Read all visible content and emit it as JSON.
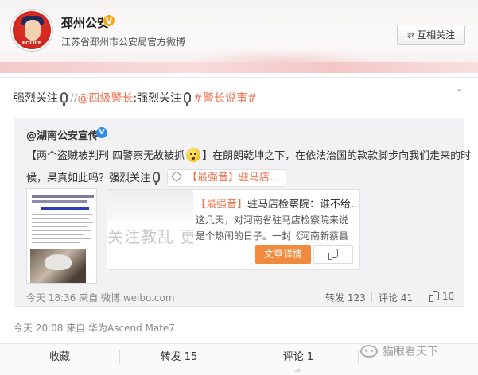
{
  "header": {
    "account_name": "邳州公安",
    "verified_badge": "V",
    "description": "江苏省邳州市公安局官方微博",
    "follow_button": "互相关注",
    "follow_icon": "mutual-follow-arrows"
  },
  "post": {
    "more_icon": "chevron-down-icon",
    "text_prefix": "强烈关注",
    "separator": "//",
    "mention": "@四级警长",
    "mention_colon": ":强烈关注",
    "hashtag": "#警长说事#",
    "time": "今天 20:08 来自 华为Ascend Mate7"
  },
  "quoted": {
    "author": "@湖南公安宣传",
    "verified_badge": "V",
    "line1_before_emoji": "【两个盗贼被判刑 四警察无故被抓",
    "line1_after_emoji": "】在朗朗乾坤之下，在依法治国的款款脚步向我们走来的时",
    "line2": "候，果真如此吗？强烈关注",
    "link_chip": "【最强音】驻马店...",
    "card": {
      "title_highlight": "【最强音】",
      "title_rest": "驻马店检察院：谁不给...",
      "desc_line1": "这几天，对河南省驻马店检察院来说",
      "desc_line2": "是个热闹的日子。一封《河南新蔡县",
      "blur_text": "关注教乱 更加",
      "action_button": "文章详情"
    },
    "time": "今天 18:36 来自 微博 weibo.com",
    "repost": "转发 123",
    "comment": "评论 41",
    "like": "10"
  },
  "tabs": {
    "favorite": "收藏",
    "repost": "转发 15",
    "comment": "评论 1"
  },
  "watermark": "猫眼看天下",
  "colors": {
    "link": "#eb7350",
    "button_orange": "#f08a3c",
    "badge_gold": "#f5a623",
    "badge_blue": "#2d8ee6"
  }
}
